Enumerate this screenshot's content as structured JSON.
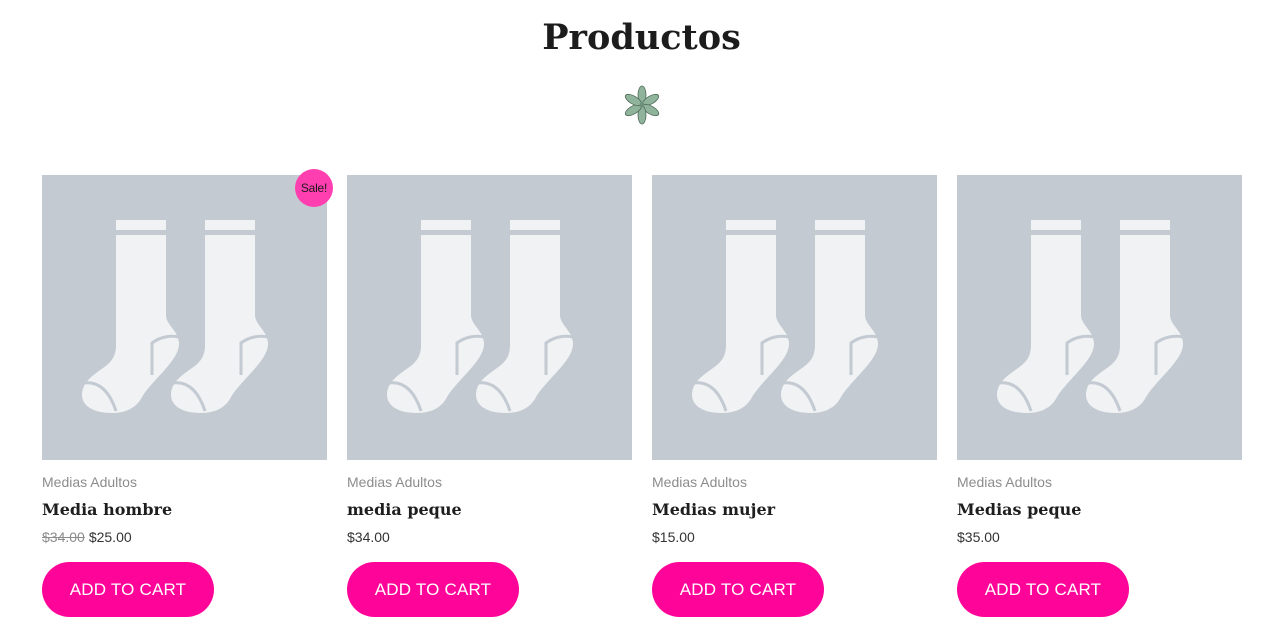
{
  "section": {
    "title": "Productos",
    "divider_icon": "flower-icon"
  },
  "products": [
    {
      "image_icon": "socks-placeholder-icon",
      "category": "Medias Adultos",
      "name": "Media hombre",
      "price_old": "$34.00",
      "price": "$25.00",
      "badge": "Sale!",
      "button_label": "ADD TO CART"
    },
    {
      "image_icon": "socks-placeholder-icon",
      "category": "Medias Adultos",
      "name": "media peque",
      "price": "$34.00",
      "button_label": "ADD TO CART"
    },
    {
      "image_icon": "socks-placeholder-icon",
      "category": "Medias Adultos",
      "name": "Medias mujer",
      "price": "$15.00",
      "button_label": "ADD TO CART"
    },
    {
      "image_icon": "socks-placeholder-icon",
      "category": "Medias Adultos",
      "name": "Medias peque",
      "price": "$35.00",
      "button_label": "ADD TO CART"
    }
  ],
  "colors": {
    "accent": "#ff0498",
    "badge": "#ff3fb0",
    "placeholder_bg": "#c3cad2",
    "sock": "#f0f2f4",
    "flower": "#8fb39b"
  }
}
